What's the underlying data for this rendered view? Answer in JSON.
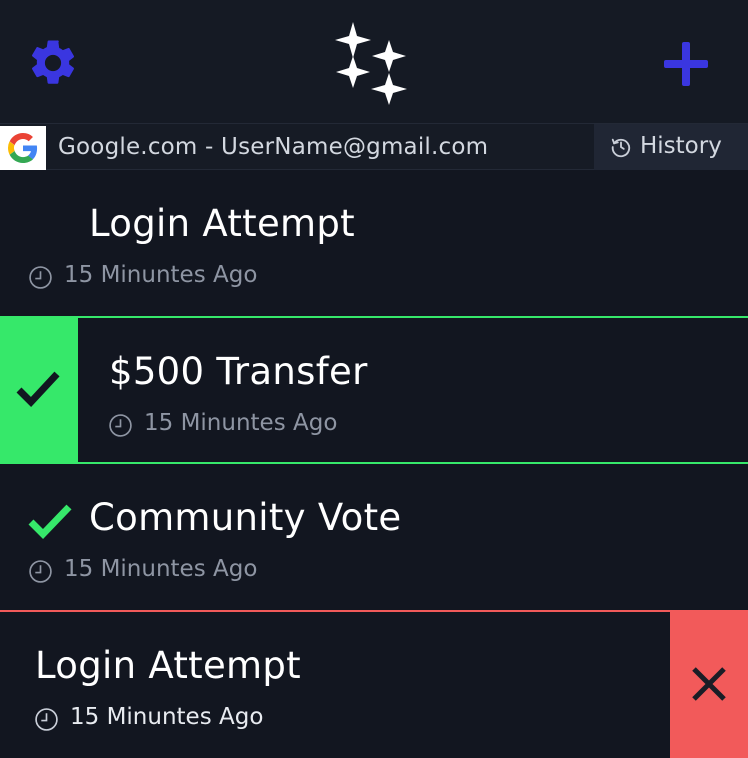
{
  "header": {
    "settings_icon": "gear-icon",
    "logo_icon": "sparkles-logo",
    "add_icon": "plus-icon",
    "accent_color": "#3a36e0"
  },
  "account": {
    "provider_icon": "google-logo",
    "label": "Google.com - UserName@gmail.com",
    "history_label": "History",
    "history_icon": "history-icon"
  },
  "requests": [
    {
      "title": "Login Attempt",
      "time": "15 Minuntes Ago",
      "status": "pending"
    },
    {
      "title": "$500 Transfer",
      "time": "15 Minuntes Ago",
      "status": "approving",
      "status_color": "#36e86a"
    },
    {
      "title": "Community Vote",
      "time": "15 Minuntes Ago",
      "status": "approved",
      "status_color": "#36e86a"
    },
    {
      "title": "Login Attempt",
      "time": "15 Minuntes Ago",
      "status": "rejecting",
      "status_color": "#f25a5a"
    }
  ]
}
